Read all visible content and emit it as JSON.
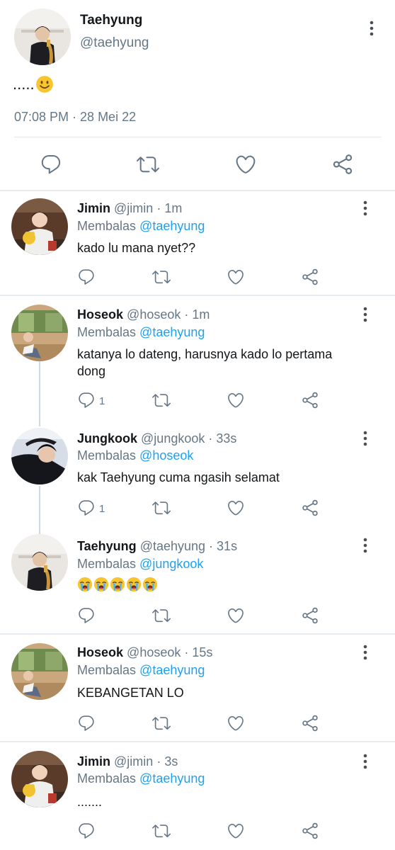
{
  "main_tweet": {
    "name": "Taehyung",
    "handle": "@taehyung",
    "text": ".....",
    "emoji": "slightly-smiling-face",
    "timestamp": "07:08 PM · 28 Mei 22"
  },
  "replies": [
    {
      "name": "Jimin",
      "handle": "@jimin",
      "time": "· 1m",
      "replying_label": "Membalas",
      "replying_to": "@taehyung",
      "text": "kado lu mana nyet??",
      "reply_count": ""
    },
    {
      "name": "Hoseok",
      "handle": "@hoseok",
      "time": "· 1m",
      "replying_label": "Membalas",
      "replying_to": "@taehyung",
      "text": "katanya lo dateng, harusnya kado lo pertama dong",
      "reply_count": "1"
    },
    {
      "name": "Jungkook",
      "handle": "@jungkook",
      "time": "· 33s",
      "replying_label": "Membalas",
      "replying_to": "@hoseok",
      "text": "kak Taehyung cuma ngasih selamat",
      "reply_count": "1"
    },
    {
      "name": "Taehyung",
      "handle": "@taehyung",
      "time": "· 31s",
      "replying_label": "Membalas",
      "replying_to": "@jungkook",
      "text": "",
      "emoji": "loudly-crying-face x5",
      "reply_count": ""
    },
    {
      "name": "Hoseok",
      "handle": "@hoseok",
      "time": "· 15s",
      "replying_label": "Membalas",
      "replying_to": "@taehyung",
      "text": "KEBANGETAN LO",
      "reply_count": ""
    },
    {
      "name": "Jimin",
      "handle": "@jimin",
      "time": "· 3s",
      "replying_label": "Membalas",
      "replying_to": "@taehyung",
      "text": ".......",
      "reply_count": ""
    }
  ],
  "icons": [
    "reply-icon",
    "retweet-icon",
    "like-icon",
    "share-icon",
    "more-options-icon"
  ],
  "colors": {
    "text": "#14171a",
    "secondary": "#657786",
    "link": "#1da1f2",
    "divider": "#e1e8ed"
  }
}
